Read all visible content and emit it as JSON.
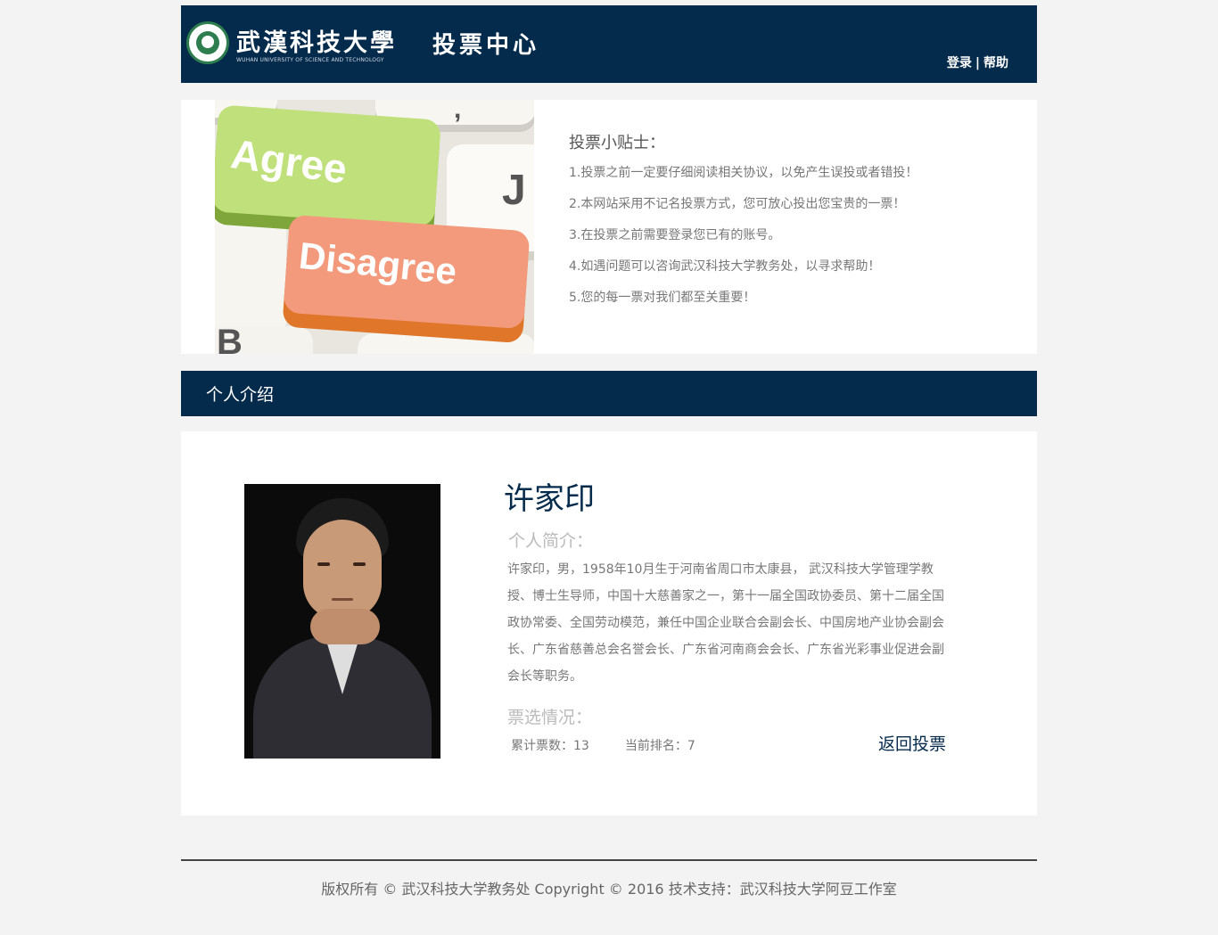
{
  "header": {
    "logo_cn": "武漢科技大學",
    "logo_en": "WUHAN UNIVERSITY OF SCIENCE AND TECHNOLOGY",
    "site_title": "投票中心",
    "login_label": "登录",
    "separator": "|",
    "help_label": "帮助",
    "bg_color": "#042a4c"
  },
  "tips": {
    "image_keys": {
      "agree": "Agree",
      "disagree": "Disagree"
    },
    "title": "投票小贴士：",
    "items": [
      "1.投票之前一定要仔细阅读相关协议，以免产生误投或者错投！",
      "2.本网站采用不记名投票方式，您可放心投出您宝贵的一票！",
      "3.在投票之前需要登录您已有的账号。",
      "4.如遇问题可以咨询武汉科技大学教务处，以寻求帮助！",
      "5.您的每一票对我们都至关重要！"
    ]
  },
  "section": {
    "title": "个人介绍"
  },
  "profile": {
    "name": "许家印",
    "intro_label": "个人简介：",
    "intro_text": "许家印，男，1958年10月生于河南省周口市太康县， 武汉科技大学管理学教授、博士生导师，中国十大慈善家之一，第十一届全国政协委员、第十二届全国政协常委、全国劳动模范，兼任中国企业联合会副会长、中国房地产业协会副会长、广东省慈善总会名誉会长、广东省河南商会会长、广东省光彩事业促进会副会长等职务。",
    "vote_label": "票选情况：",
    "total_votes": "累计票数：13",
    "current_rank": "当前排名：7",
    "back_label": "返回投票"
  },
  "footer": {
    "text": "版权所有 © 武汉科技大学教务处 Copyright © 2016   技术支持：武汉科技大学阿豆工作室"
  }
}
